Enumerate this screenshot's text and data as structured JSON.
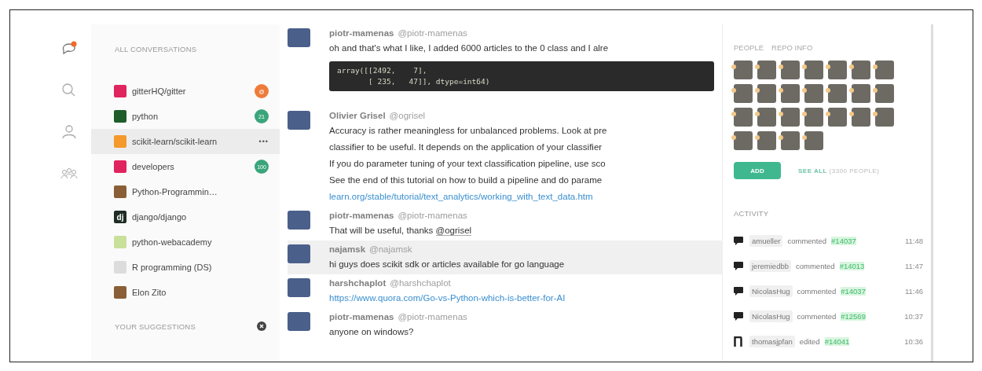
{
  "rail": [
    {
      "kind": "chat",
      "alert": true
    },
    {
      "kind": "search"
    },
    {
      "kind": "person"
    },
    {
      "kind": "group"
    }
  ],
  "conversations": {
    "heading": "ALL CONVERSATIONS",
    "items": [
      {
        "name": "gitterHQ/gitter",
        "kind": "gitter",
        "badge": "@",
        "color": "#ef7b3a",
        "selected": false
      },
      {
        "name": "python",
        "kind": "python",
        "badge": "21",
        "color": "#3aa57a",
        "selected": false
      },
      {
        "name": "scikit-learn/scikit-learn",
        "kind": "scikit",
        "selected": true,
        "menu": "•••"
      },
      {
        "name": "developers",
        "kind": "gitter",
        "badge": "100",
        "color": "#3aa57a",
        "selected": false
      },
      {
        "name": "Python-Programmin…",
        "kind": "photo",
        "selected": false
      },
      {
        "name": "django/django",
        "kind": "django",
        "avatar_text": "dj",
        "selected": false
      },
      {
        "name": "python-webacademy",
        "kind": "webacademy",
        "selected": false
      },
      {
        "name": "R programming (DS)",
        "kind": "blank",
        "selected": false
      },
      {
        "name": "Elon Zito",
        "kind": "photo",
        "selected": false
      }
    ]
  },
  "suggestions": {
    "heading": "YOUR SUGGESTIONS"
  },
  "messages": [
    {
      "user": "piotr-mamenas",
      "handle": "@piotr-mamenas",
      "highlighted": false,
      "parts": [
        {
          "kind": "text",
          "text": "oh and that's what I like, I added 6000 articles to the 0 class and I alre"
        },
        {
          "kind": "code",
          "lines": [
            "array([[2492,    7],",
            "       [ 235,   47]], dtype=int64)"
          ]
        }
      ]
    },
    {
      "user": "Olivier Grisel",
      "handle": "@ogrisel",
      "highlighted": false,
      "parts": [
        {
          "kind": "text",
          "text": "Accuracy is rather meaningless for unbalanced problems. Look at pre"
        },
        {
          "kind": "text",
          "text": "classifier to be useful. It depends on the application of your classifier"
        },
        {
          "kind": "text",
          "text": "If you do parameter tuning of your text classification pipeline, use sco"
        },
        {
          "kind": "text",
          "text": "See the end of this tutorial on how to build a pipeline and do parame"
        },
        {
          "kind": "link",
          "text": "learn.org/stable/tutorial/text_analytics/working_with_text_data.htm"
        }
      ]
    },
    {
      "user": "piotr-mamenas",
      "handle": "@piotr-mamenas",
      "highlighted": false,
      "parts": [
        {
          "kind": "text",
          "text": "That will be useful, thanks",
          "mention": "@ogrisel"
        }
      ]
    },
    {
      "user": "najamsk",
      "handle": "@najamsk",
      "highlighted": true,
      "parts": [
        {
          "kind": "text",
          "text": "hi guys does scikit sdk or articles available for go language"
        }
      ]
    },
    {
      "user": "harshchaplot",
      "handle": "@harshchaplot",
      "highlighted": false,
      "parts": [
        {
          "kind": "link",
          "text": "https://www.quora.com/Go-vs-Python-which-is-better-for-AI"
        }
      ]
    },
    {
      "user": "piotr-mamenas",
      "handle": "@piotr-mamenas",
      "highlighted": false,
      "parts": [
        {
          "kind": "text",
          "text": "anyone on windows?"
        }
      ]
    }
  ],
  "people": {
    "tabs": [
      "PEOPLE",
      "REPO INFO"
    ],
    "avatars": [
      {
        "online": true
      },
      {
        "online": true
      },
      {
        "online": true
      },
      {
        "online": true
      },
      {
        "online": true
      },
      {
        "online": true
      },
      {
        "online": true
      },
      {
        "online": true
      },
      {
        "online": true
      },
      {
        "online": true
      },
      {
        "online": true
      },
      {
        "online": true
      },
      {
        "online": true
      },
      {
        "online": true
      },
      {
        "online": true
      },
      {
        "online": true
      },
      {
        "online": true
      },
      {
        "online": true
      },
      {
        "online": true
      },
      {
        "online": true
      },
      {
        "online": true
      },
      {
        "online": true
      },
      {
        "online": true
      },
      {
        "online": true
      },
      {
        "online": true
      }
    ],
    "add_button": "ADD",
    "see_all": "SEE ALL",
    "count": "(3300 PEOPLE)"
  },
  "activity": {
    "heading": "ACTIVITY",
    "items": [
      {
        "kind": "comment",
        "user": "amueller",
        "action": "commented",
        "issue": "#14037",
        "time": "11:48"
      },
      {
        "kind": "comment",
        "user": "jeremiedbb",
        "action": "commented",
        "issue": "#14013",
        "time": "11:47"
      },
      {
        "kind": "comment",
        "user": "NicolasHug",
        "action": "commented",
        "issue": "#14037",
        "time": "11:46"
      },
      {
        "kind": "comment",
        "user": "NicolasHug",
        "action": "commented",
        "issue": "#12569",
        "time": "10:37"
      },
      {
        "kind": "edit",
        "user": "thomasjpfan",
        "action": "edited",
        "issue": "#14041",
        "time": "10:36"
      }
    ]
  }
}
